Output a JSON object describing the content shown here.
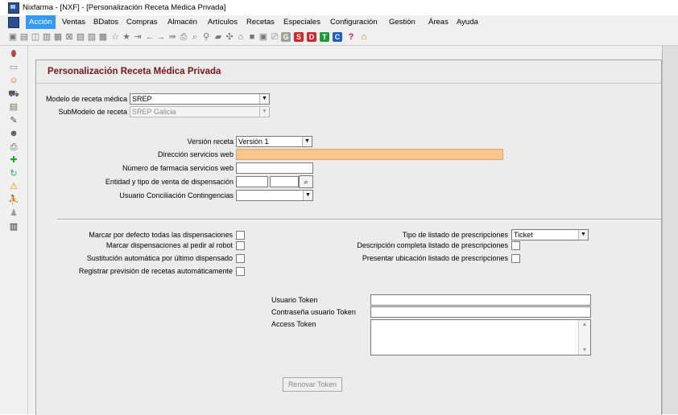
{
  "window": {
    "title": "Nixfarma - [NXF] - [Personalización Receta Médica Privada]"
  },
  "menu": [
    "Acción",
    "Ventas",
    "BDatos",
    "Compras",
    "Almacén",
    "Artículos",
    "Recetas",
    "Especiales",
    "Configuración",
    "Gestión",
    "Áreas",
    "Ayuda"
  ],
  "toolbar_icons": [
    {
      "name": "toolbar-tool-1-icon",
      "glyph": "▣"
    },
    {
      "name": "toolbar-tool-2-icon",
      "glyph": "▤"
    },
    {
      "name": "toolbar-tool-3-icon",
      "glyph": "◫"
    },
    {
      "name": "toolbar-tool-4-icon",
      "glyph": "▥"
    },
    {
      "name": "toolbar-tool-5-icon",
      "glyph": "▦"
    },
    {
      "name": "toolbar-tool-6-icon",
      "glyph": "⊠"
    },
    {
      "name": "toolbar-tool-7-icon",
      "glyph": "▧"
    },
    {
      "name": "toolbar-tool-8-icon",
      "glyph": "▨"
    },
    {
      "name": "toolbar-tool-9-icon",
      "glyph": "▩"
    },
    {
      "name": "star-outline-icon",
      "glyph": "☆"
    },
    {
      "name": "star-icon",
      "glyph": "★"
    },
    {
      "name": "toolbar-tool-10-icon",
      "glyph": "⇥"
    },
    {
      "name": "arrow-left-icon",
      "glyph": "←"
    },
    {
      "name": "arrow-right-icon",
      "glyph": "→"
    },
    {
      "name": "toolbar-tool-11-icon",
      "glyph": "⇛"
    },
    {
      "name": "printer-icon",
      "glyph": "⎙"
    },
    {
      "name": "search-icon",
      "glyph": "⌕"
    },
    {
      "name": "location-pin-icon",
      "glyph": "⚲"
    },
    {
      "name": "toolbar-tool-12-icon",
      "glyph": "▰"
    },
    {
      "name": "toolbar-tool-13-icon",
      "glyph": "✣"
    },
    {
      "name": "toolbar-tool-14-icon",
      "glyph": "⌂"
    },
    {
      "name": "toolbar-tool-15-icon",
      "glyph": "■"
    },
    {
      "name": "toolbar-tool-16-icon",
      "glyph": "▣"
    },
    {
      "name": "toolbar-tool-17-icon",
      "glyph": "⎚"
    },
    {
      "name": "badge-g-icon",
      "glyph": "G",
      "bg": "#9aa39a"
    },
    {
      "name": "badge-s-icon",
      "glyph": "S",
      "bg": "#d9232d"
    },
    {
      "name": "badge-d-icon",
      "glyph": "D",
      "bg": "#d9232d"
    },
    {
      "name": "badge-t-icon",
      "glyph": "T",
      "bg": "#1f9a3a"
    },
    {
      "name": "badge-c-icon",
      "glyph": "C",
      "bg": "#1f5fc8"
    },
    {
      "name": "help-icon",
      "glyph": "?",
      "color": "#d9232d"
    },
    {
      "name": "home-icon",
      "glyph": "⌂",
      "color": "#c96a10"
    }
  ],
  "sidebar_icons": [
    {
      "name": "sidebar-pill-icon",
      "glyph": "⬮",
      "color": "#b44"
    },
    {
      "name": "sidebar-box-icon",
      "glyph": "▭",
      "color": "#887"
    },
    {
      "name": "sidebar-person-icon",
      "glyph": "☺",
      "color": "#a70"
    },
    {
      "name": "sidebar-cart-icon",
      "glyph": "⛟",
      "color": "#555"
    },
    {
      "name": "sidebar-package-icon",
      "glyph": "▤",
      "color": "#775"
    },
    {
      "name": "sidebar-pencil-icon",
      "glyph": "✎",
      "color": "#555"
    },
    {
      "name": "sidebar-users-icon",
      "glyph": "☻",
      "color": "#555"
    },
    {
      "name": "sidebar-printer-icon",
      "glyph": "⎙",
      "color": "#555"
    },
    {
      "name": "sidebar-cross-icon",
      "glyph": "✚",
      "color": "#2a2"
    },
    {
      "name": "sidebar-refresh-icon",
      "glyph": "↻",
      "color": "#2a5"
    },
    {
      "name": "sidebar-warning-icon",
      "glyph": "⚠",
      "color": "#d90"
    },
    {
      "name": "sidebar-walk-icon",
      "glyph": "⛹",
      "color": "#777"
    },
    {
      "name": "sidebar-group-icon",
      "glyph": "♟",
      "color": "#999"
    },
    {
      "name": "sidebar-barcode-icon",
      "glyph": "▥",
      "color": "#222"
    }
  ],
  "form": {
    "title": "Personalización Receta Médica Privada",
    "modelo_label": "Modelo de receta médica",
    "modelo_value": "SREP",
    "submodelo_label": "SubModelo de receta",
    "submodelo_value": "SREP Galicia",
    "version_label": "Versión receta",
    "version_value": "Versión 1",
    "direccion_label": "Dirección servicios web",
    "numero_label": "Número de farmacia servicios web",
    "entidad_label": "Entidad y tipo de venta de dispensación",
    "usuario_conc_label": "Usuario Conciliación Contingencias",
    "marcar_defecto_label": "Marcar por defecto todas las dispensaciones",
    "marcar_pedir_label": "Marcar dispensaciones al pedir al robot",
    "sustitucion_label": "Sustitución automática por último dispensado",
    "registrar_label": "Registrar previsión de recetas automáticamente",
    "tipo_listado_label": "Tipo de listado de prescripciones",
    "tipo_listado_value": "Ticket",
    "descripcion_label": "Descripción completa listado de prescripciones",
    "presentar_label": "Presentar ubicación listado de prescripciones",
    "usuario_token_label": "Usuario Token",
    "contrasena_token_label": "Contraseña usuario Token",
    "access_token_label": "Access Token",
    "renovar_label": "Renovar Token"
  }
}
